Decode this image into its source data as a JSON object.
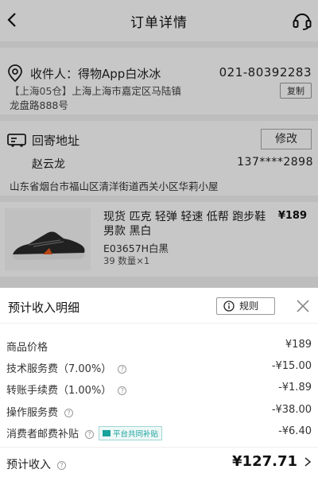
{
  "header": {
    "title": "订单详情"
  },
  "receiver": {
    "label": "收件人：",
    "name": "得物App白冰冰",
    "phone": "021-80392283",
    "tag": "【上海05仓】",
    "address_line1": "上海上海市嘉定区马陆镇",
    "address_line2": "龙盘路888号",
    "copy_label": "复制"
  },
  "return_address": {
    "label": "回寄地址",
    "edit_label": "修改",
    "name": "赵云龙",
    "phone": "137****2898",
    "address": "山东省烟台市福山区清洋街道西关小区华莉小屋"
  },
  "product": {
    "title": "现货 匹克 轻弹 轻速 低帮 跑步鞋 男款 黑白",
    "price": "¥189",
    "sku": "E03657H白黑",
    "qty": "39 数量×1"
  },
  "sheet": {
    "title": "预计收入明细",
    "rules_label": "规则",
    "rows": [
      {
        "label": "商品价格",
        "value": "¥189"
      },
      {
        "label": "技术服务费（7.00%）",
        "value": "-¥15.00"
      },
      {
        "label": "转账手续费（1.00%）",
        "value": "-¥1.89"
      },
      {
        "label": "操作服务费",
        "value": "-¥38.00"
      },
      {
        "label": "消费者邮费补贴",
        "value": "-¥6.40",
        "badge": "平台共同补贴"
      }
    ],
    "total_label": "预计收入",
    "total_value": "¥127.71"
  },
  "colors": {
    "badge_teal": "#18a29c",
    "overlay": "rgba(0,0,0,0.22)"
  }
}
